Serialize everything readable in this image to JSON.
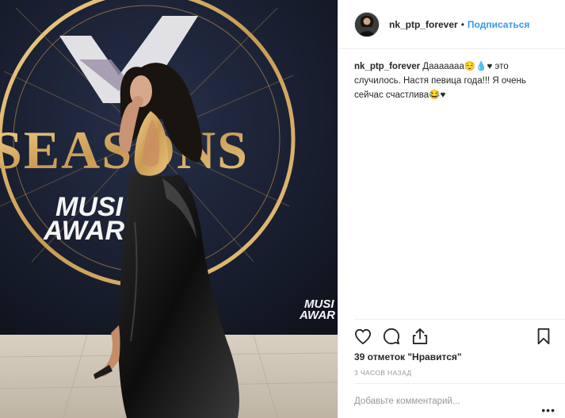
{
  "post": {
    "username": "nk_ptp_forever",
    "separator": "•",
    "follow_label": "Подписаться",
    "caption_user": "nk_ptp_forever",
    "caption_text": " Дааааааа😌💧♥ это случилось. Настя певица года!!! Я очень сейчас счастлива😂♥",
    "likes_text": "39 отметок \"Нравится\"",
    "timestamp": "3 часов назад",
    "comment_placeholder": "Добавьте комментарий...",
    "more_dots": "•••"
  },
  "photo": {
    "backdrop_big_word": "SEASONS",
    "backdrop_sub_word_1": "MUSI",
    "backdrop_sub_word_2": "AWAR",
    "backdrop_corner_word_1": "MUSI",
    "backdrop_corner_word_2": "AWAR"
  },
  "icons": {
    "like": "heart-icon",
    "comment": "comment-icon",
    "share": "share-icon",
    "save": "bookmark-icon"
  },
  "colors": {
    "accent": "#3897f0",
    "text": "#262626",
    "muted": "#999999",
    "divider": "#efefef",
    "gold": "#d7a860"
  }
}
